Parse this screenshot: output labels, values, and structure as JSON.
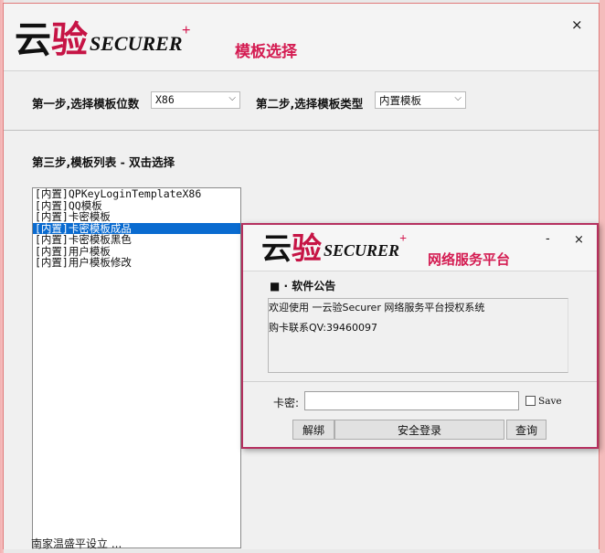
{
  "main_window": {
    "logo": {
      "zh_part1": "云",
      "zh_part2": "验",
      "en": "SECURER",
      "plus": "+"
    },
    "title": "模板选择",
    "close_symbol": "×",
    "step1_label": "第一步,选择模板位数",
    "step1_value": "X86",
    "step2_label": "第二步,选择模板类型",
    "step2_value": "内置模板",
    "step3_label": "第三步,模板列表 - 双击选择",
    "templates": [
      "[内置]QPKeyLoginTemplateX86",
      "[内置]QQ模板",
      "[内置]卡密模板",
      "[内置]卡密模板成品",
      "[内置]卡密模板黑色",
      "[内置]用户模板",
      "[内置]用户模板修改"
    ],
    "selected_index": 3,
    "bottom_text": "南家温盛平设立 ..."
  },
  "login_dialog": {
    "logo": {
      "zh_part1": "云",
      "zh_part2": "验",
      "en": "SECURER",
      "plus": "+"
    },
    "title": "网络服务平台",
    "minimize_symbol": "-",
    "close_symbol": "×",
    "notice_title": "■ · 软件公告",
    "notice_lines": [
      "欢迎使用 一云验Securer 网络服务平台授权系统",
      "购卡联系QV:39460097"
    ],
    "card_label": "卡密:",
    "card_value": "",
    "save_label": "Save",
    "buttons": {
      "unbind": "解绑",
      "login": "安全登录",
      "query": "查询"
    }
  },
  "colors": {
    "accent": "#d41c52",
    "selection": "#0a6bd0",
    "dialog_border": "#b5305f"
  },
  "icons": [
    "chevron-down-icon",
    "close-icon",
    "minimize-icon"
  ]
}
